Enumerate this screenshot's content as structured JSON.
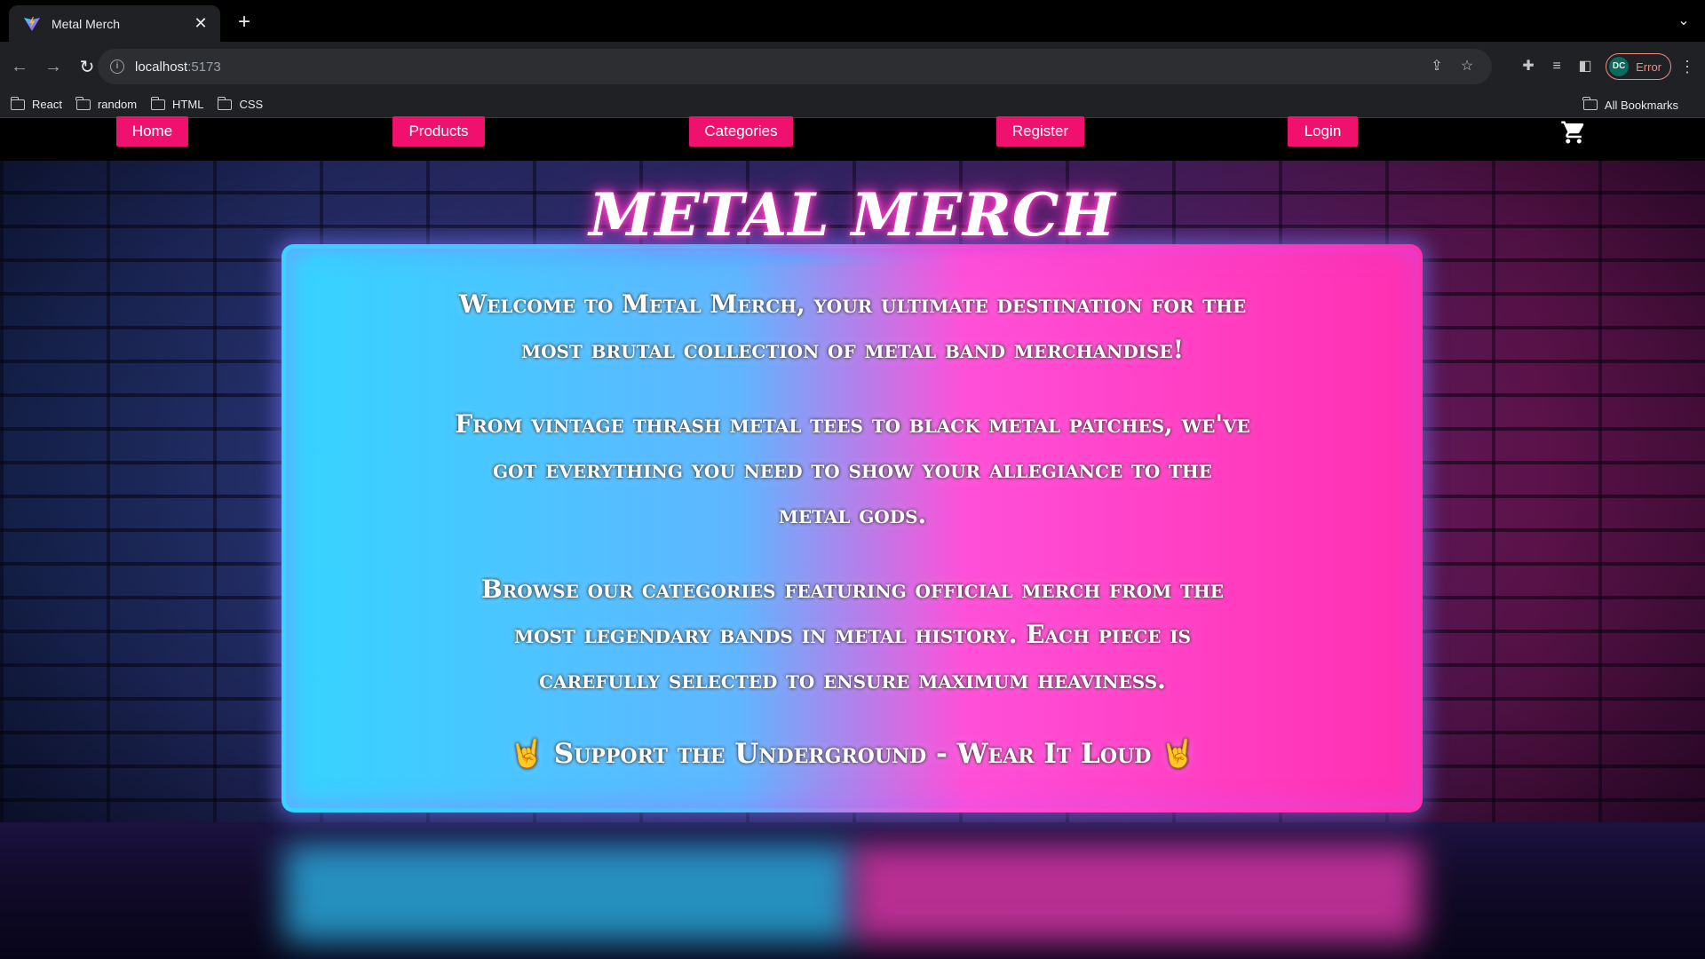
{
  "browser": {
    "tab_title": "Metal Merch",
    "tab_close_icon": "close-icon",
    "new_tab_icon": "plus-icon",
    "url_host": "localhost",
    "url_port": ":5173",
    "profile_initials": "DC",
    "profile_status": "Error",
    "bookmarks": [
      "React",
      "random",
      "HTML",
      "CSS"
    ],
    "all_bookmarks": "All Bookmarks"
  },
  "nav": {
    "home": "Home",
    "products": "Products",
    "categories": "Categories",
    "register": "Register",
    "login": "Login",
    "cart_icon": "cart-icon",
    "accent": "#f0116f"
  },
  "hero": {
    "title": "METAL MERCH",
    "paragraphs": [
      "Welcome to Metal Merch, your ultimate destination for the most brutal collection of metal band merchandise!",
      "From vintage thrash metal tees to black metal patches, we've got everything you need to show your allegiance to the metal gods.",
      "Browse our categories featuring official merch from the most legendary bands in metal history. Each piece is carefully selected to ensure maximum heaviness."
    ],
    "tagline": "🤘 Support the Underground - Wear It Loud 🤘",
    "neon_colors": [
      "#35d4ff",
      "#ff2fb0"
    ]
  }
}
